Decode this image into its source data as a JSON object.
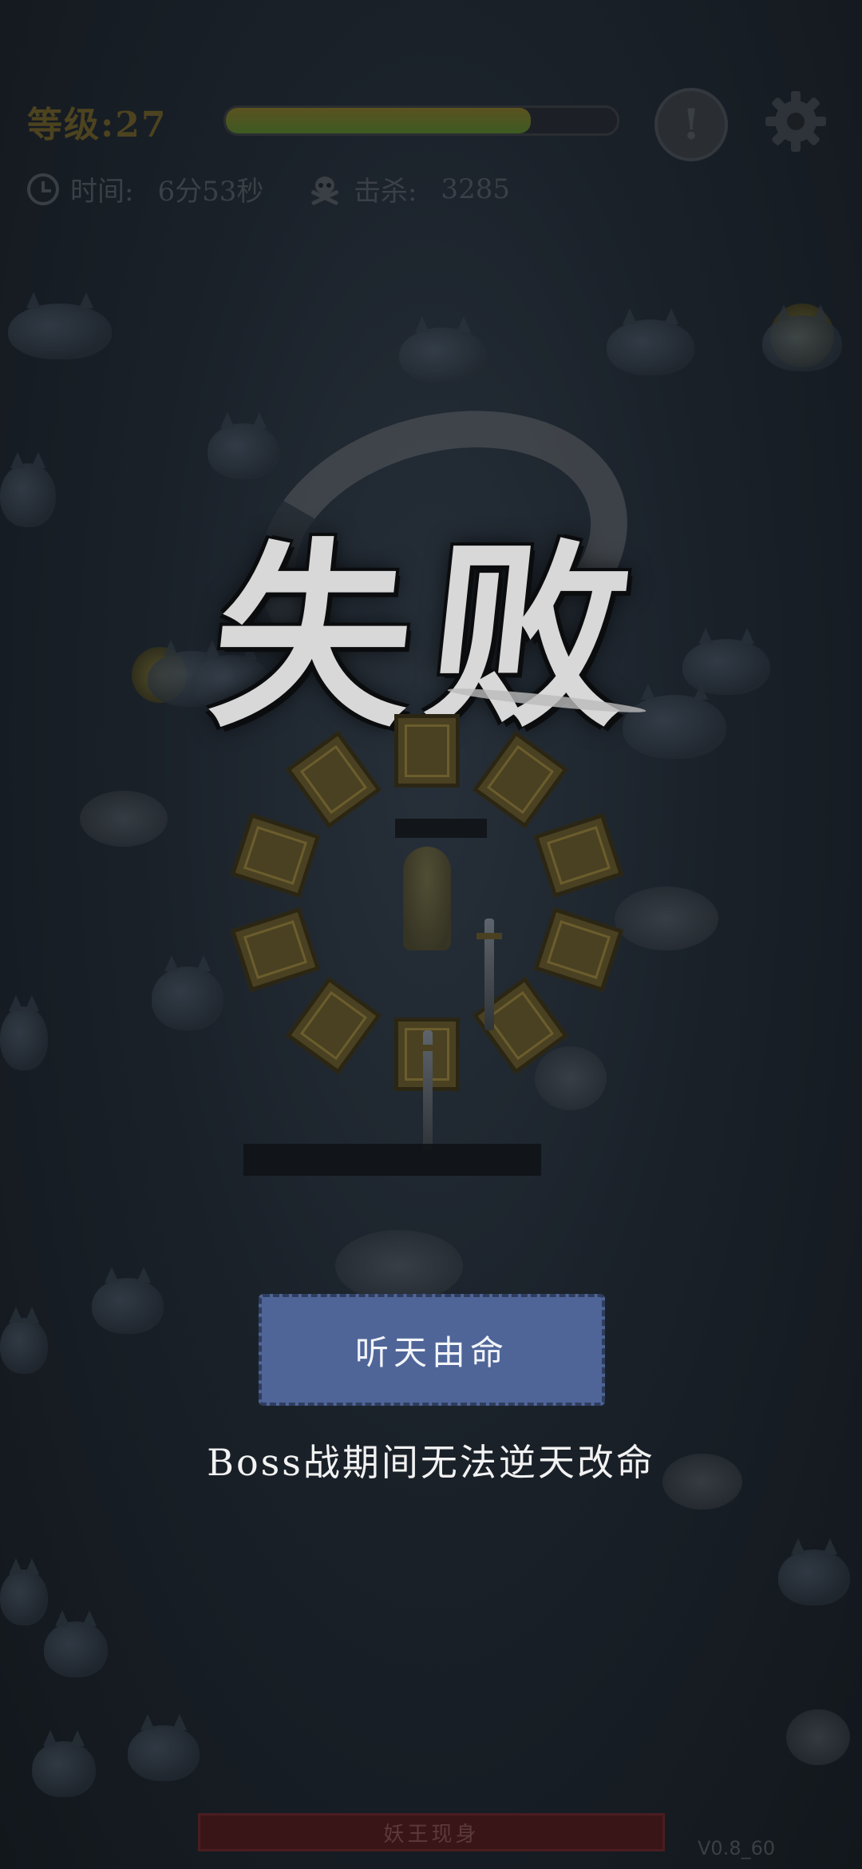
{
  "hud": {
    "level_label": "等级:27",
    "xp_progress_pct": 78,
    "time_label": "时间:",
    "time_value": "6分53秒",
    "kills_label": "击杀:",
    "kills_value": "3285",
    "hint_glyph": "!",
    "icons": {
      "clock": "clock-icon",
      "skull": "skull-icon",
      "gear": "gear-icon",
      "hint": "exclamation-icon"
    }
  },
  "result": {
    "title": "失败"
  },
  "dialog": {
    "accept_fate_label": "听天由命",
    "boss_message": "Boss战期间无法逆天改命",
    "button_color": "#4f6598"
  },
  "footer": {
    "boss_banner": "妖王现身",
    "version": "V0.8_60"
  }
}
